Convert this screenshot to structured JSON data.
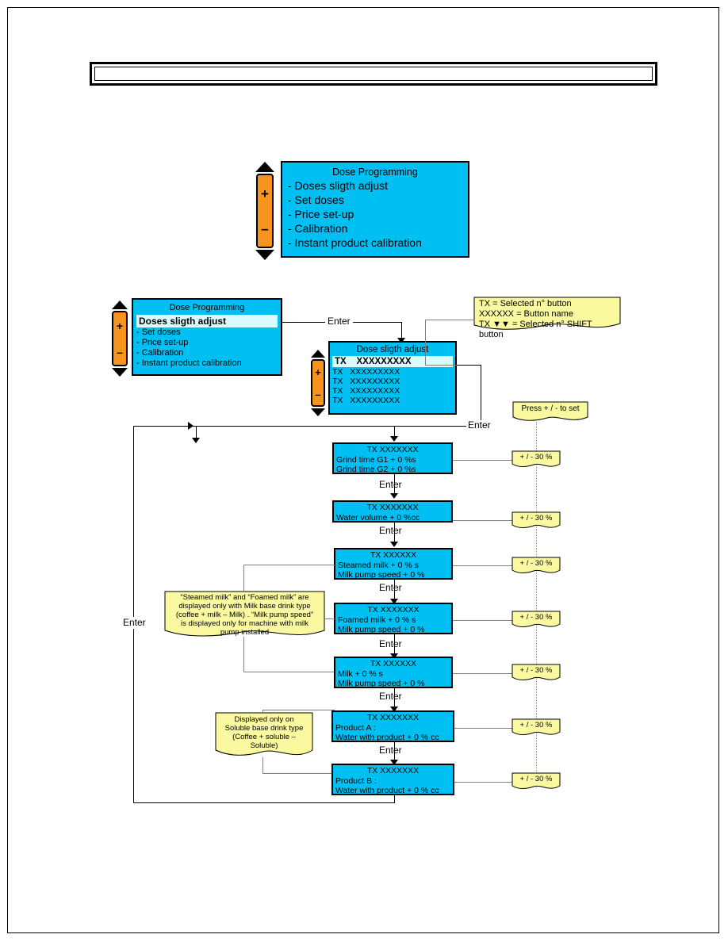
{
  "header": {
    "title": ""
  },
  "menu_panel": {
    "title": "Dose Programming",
    "items": [
      "- Doses sligth adjust",
      "- Set doses",
      "- Price set-up",
      "- Calibration",
      "- Instant product calibration"
    ]
  },
  "menu_panel_selected": {
    "title": "Dose Programming",
    "selected_item": "Doses sligth adjust",
    "items": [
      "- Set doses",
      "- Price set-up",
      "- Calibration",
      "- Instant product calibration"
    ]
  },
  "list_panel": {
    "title": "Dose sligth adjust",
    "selected_prefix": "TX",
    "selected_value": "XXXXXXXXX",
    "rows": [
      {
        "prefix": "TX",
        "value": "XXXXXXXXX"
      },
      {
        "prefix": "TX",
        "value": "XXXXXXXXX"
      },
      {
        "prefix": "TX",
        "value": "XXXXXXXXX"
      },
      {
        "prefix": "TX",
        "value": "XXXXXXXXX"
      }
    ]
  },
  "legend_note": {
    "line1": "TX = Selected  n° button",
    "line2": "XXXXXX = Button name",
    "line3": "TX ▼▼ = Selected  n° SHIFT button"
  },
  "press_note": {
    "text": "Press + / - to set"
  },
  "steps": [
    {
      "name": "grind-time",
      "title": "TX   XXXXXXX",
      "lines": [
        "Grind time   G1      + 0  %s",
        "Grind time   G2      + 0  %s"
      ],
      "range": "+ / - 30 %"
    },
    {
      "name": "water-volume",
      "title": "TX   XXXXXXX",
      "lines": [
        "Water volume  + 0 %cc"
      ],
      "range": "+ / - 30 %"
    },
    {
      "name": "steamed-milk",
      "title": "TX  XXXXXX",
      "lines": [
        "Steamed milk      + 0 % s",
        "Milk pump speed  + 0 %"
      ],
      "range": "+ / - 30 %"
    },
    {
      "name": "foamed-milk",
      "title": "TX  XXXXXXX",
      "lines": [
        "Foamed milk       + 0 % s",
        "Milk pump speed  + 0 %"
      ],
      "range": "+ / - 30 %"
    },
    {
      "name": "milk",
      "title": "TX  XXXXXX",
      "lines": [
        "Milk                     + 0 % s",
        "Milk pump speed  + 0 %"
      ],
      "range": "+ / - 30 %"
    },
    {
      "name": "product-a",
      "title": "TX  XXXXXXX",
      "lines": [
        "Product A :",
        "Water with product   + 0 % cc"
      ],
      "range": "+ / - 30 %"
    },
    {
      "name": "product-b",
      "title": "TX  XXXXXXX",
      "lines": [
        "Product B :",
        "Water with product   + 0 % cc"
      ],
      "range": "+ / - 30 %"
    }
  ],
  "milk_note": {
    "line1": "“Steamed milk” and “Foamed milk” are",
    "line2": "displayed only with Milk base drink type",
    "line3": "(coffee + milk – Milk) . “Milk pump speed”",
    "line4": "is displayed only for machine with milk",
    "line5": "pump installed"
  },
  "soluble_note": {
    "line1": "Displayed only on",
    "line2": "Soluble base drink type",
    "line3": "(Coffee + soluble –",
    "line4": "Soluble)"
  },
  "labels": {
    "enter": "Enter",
    "enter_return": "Enter"
  },
  "colors": {
    "lcd_background": "#00BFF3",
    "lcd_highlight": "#DAFBFF",
    "note_background": "#FAF9A0",
    "scroll_bar": "#F7941E",
    "line": "#000000"
  }
}
